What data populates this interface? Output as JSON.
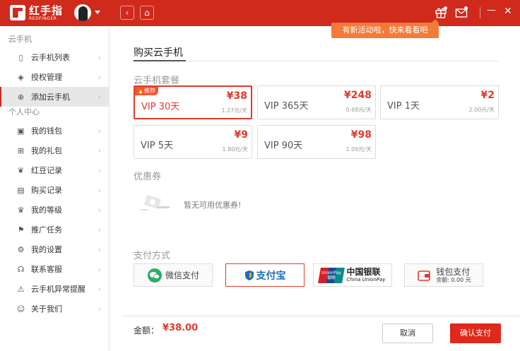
{
  "app": {
    "logo_cn": "红手指",
    "logo_en": "REDFINGER",
    "promo_tooltip": "有新活动啦，快来看看吧",
    "brand_color": "#cf2a1c"
  },
  "titlebar": {
    "back_icon": "‹",
    "home_icon": "⌂",
    "gift_icon": "gift-icon",
    "mail_icon": "mail-icon",
    "minimize_icon": "—",
    "close_icon": "✕"
  },
  "sidebar": {
    "section_cloud": "云手机",
    "section_personal": "个人中心",
    "cloud_items": [
      {
        "label": "云手机列表",
        "icon": "▯"
      },
      {
        "label": "授权管理",
        "icon": "◈"
      },
      {
        "label": "添加云手机",
        "icon": "⊕"
      }
    ],
    "personal_items": [
      {
        "label": "我的钱包",
        "icon": "▣"
      },
      {
        "label": "我的礼包",
        "icon": "⊞"
      },
      {
        "label": "红豆记录",
        "icon": "❦"
      },
      {
        "label": "购买记录",
        "icon": "▤"
      },
      {
        "label": "我的等级",
        "icon": "♛"
      },
      {
        "label": "推广任务",
        "icon": "⚑"
      },
      {
        "label": "我的设置",
        "icon": "⚙"
      },
      {
        "label": "联系客服",
        "icon": "☊"
      },
      {
        "label": "云手机异常提醒",
        "icon": "⚠"
      },
      {
        "label": "关于我们",
        "icon": "☺"
      }
    ],
    "arrow": "›"
  },
  "main": {
    "title": "购买云手机",
    "packages_label": "云手机套餐",
    "packages": [
      {
        "name": "VIP 30天",
        "price": "¥38",
        "daily": "1.27元/天",
        "badge": "推荐"
      },
      {
        "name": "VIP 365天",
        "price": "¥248",
        "daily": "0.68元/天"
      },
      {
        "name": "VIP 1天",
        "price": "¥2",
        "daily": "2.00元/天"
      },
      {
        "name": "VIP 5天",
        "price": "¥9",
        "daily": "1.80元/天"
      },
      {
        "name": "VIP 90天",
        "price": "¥98",
        "daily": "1.09元/天"
      }
    ],
    "coupon_label": "优惠券",
    "coupon_empty": "暂无可用优惠券!",
    "payment_label": "支付方式",
    "payments": {
      "wechat": "微信支付",
      "alipay": "支付宝",
      "unionpay_cn": "中国银联",
      "unionpay_en": "China UnionPay",
      "unionpay_logo": "UnionPay 银联",
      "wallet": "钱包支付",
      "wallet_balance": "余额: 0.00 元"
    },
    "amount_label": "金额：",
    "amount_value": "¥38.00",
    "cancel_button": "取消",
    "confirm_button": "确认支付"
  }
}
